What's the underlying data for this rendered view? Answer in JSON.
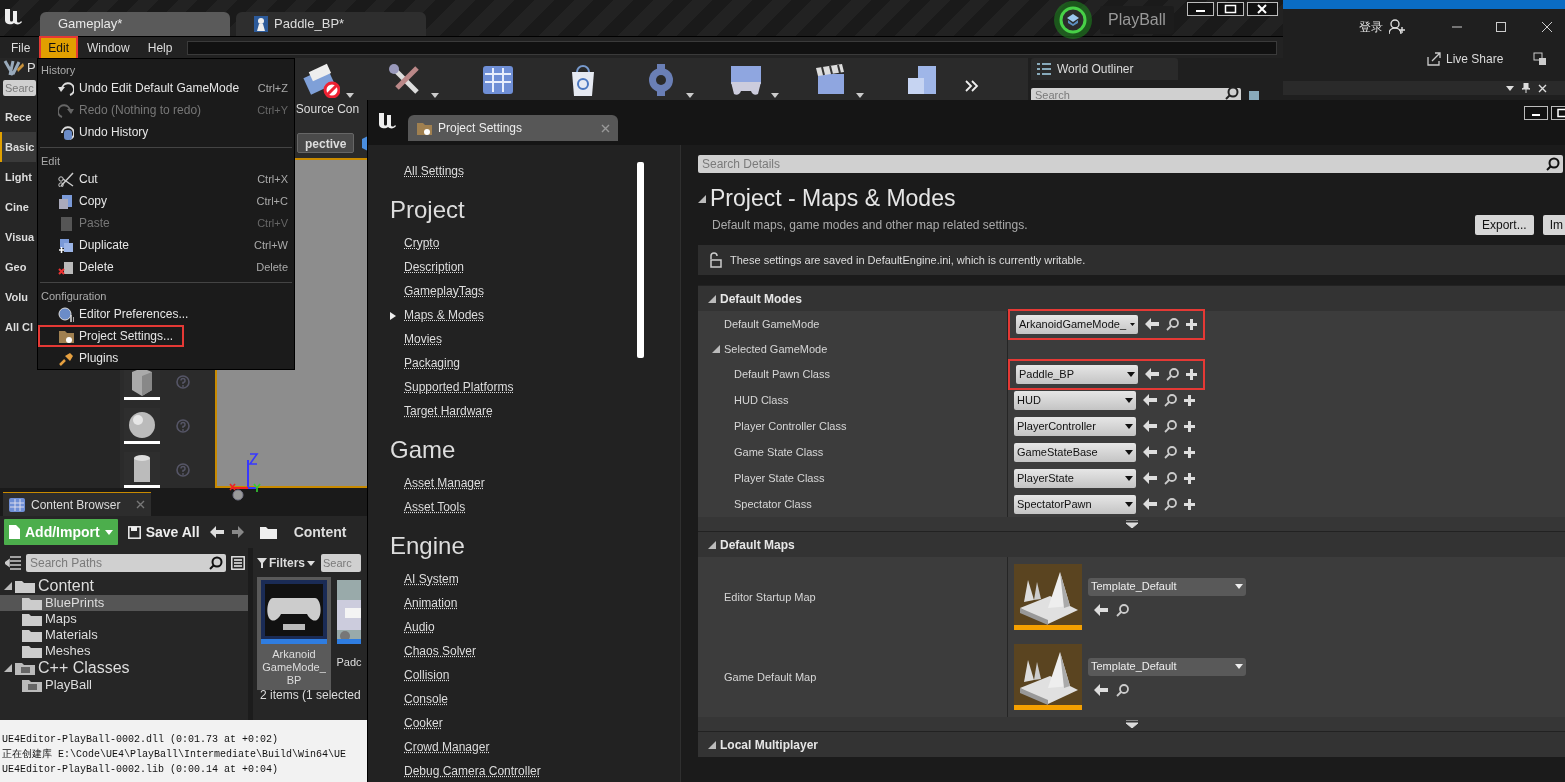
{
  "editor": {
    "tabs": [
      {
        "label": "Gameplay*",
        "selected": true
      },
      {
        "label": "Paddle_BP*",
        "selected": false
      }
    ],
    "play_title": "PlayBall",
    "menu": [
      {
        "label": "File",
        "selected": false,
        "annotated": false
      },
      {
        "label": "Edit",
        "selected": true,
        "annotated": true
      },
      {
        "label": "Window",
        "selected": false,
        "annotated": false
      },
      {
        "label": "Help",
        "selected": false,
        "annotated": false
      }
    ],
    "placement": {
      "title": "P",
      "search_placeholder": "Searc",
      "categories": [
        {
          "label": "Rece",
          "selected": false
        },
        {
          "label": "Basic",
          "selected": true
        },
        {
          "label": "Light",
          "selected": false
        },
        {
          "label": "Cine",
          "selected": false
        },
        {
          "label": "Visua",
          "selected": false
        },
        {
          "label": "Geo",
          "selected": false
        },
        {
          "label": "Volu",
          "selected": false
        },
        {
          "label": "All Cl",
          "selected": false
        }
      ]
    },
    "toolbar_label": "Source Con",
    "viewport_button": "pective",
    "world_outliner": {
      "title": "World Outliner",
      "search_placeholder": "Search"
    },
    "content_browser": {
      "title": "Content Browser",
      "add_button": "Add/Import",
      "save_button": "Save All",
      "breadcrumb": "Content",
      "path_search_placeholder": "Search Paths",
      "filters_label": "Filters",
      "asset_search_placeholder": "Searc",
      "tree": [
        {
          "label": "Content",
          "kind": "folder",
          "expanded": true,
          "selected": false,
          "children": [
            {
              "label": "BluePrints",
              "kind": "folder",
              "selected": true
            },
            {
              "label": "Maps",
              "kind": "folder",
              "selected": false
            },
            {
              "label": "Materials",
              "kind": "folder",
              "selected": false
            },
            {
              "label": "Meshes",
              "kind": "folder",
              "selected": false
            }
          ]
        },
        {
          "label": "C++ Classes",
          "kind": "class_folder",
          "expanded": true,
          "selected": false,
          "children": [
            {
              "label": "PlayBall",
              "kind": "class_folder",
              "selected": false
            }
          ]
        }
      ],
      "assets": [
        {
          "name_lines": [
            "Arkanoid",
            "GameMode_",
            "BP"
          ],
          "kind": "gamemode",
          "selected": true
        },
        {
          "name_lines": [
            "Padc"
          ],
          "kind": "mesh",
          "selected": false
        }
      ],
      "status": "2 items (1 selected"
    },
    "output_log": [
      "UE4Editor-PlayBall-0002.dll (0:01.73 at +0:02)",
      "正在创建库 E:\\Code\\UE4\\PlayBall\\Intermediate\\Build\\Win64\\UE",
      "UE4Editor-PlayBall-0002.lib (0:00.14 at +0:04)"
    ]
  },
  "ide": {
    "login": "登录",
    "live_share": "Live Share"
  },
  "edit_menu": {
    "sections": [
      {
        "heading": "History",
        "items": [
          {
            "label": "Undo Edit Default GameMode",
            "shortcut": "Ctrl+Z",
            "disabled": false,
            "annotated": false
          },
          {
            "label": "Redo (Nothing to redo)",
            "shortcut": "Ctrl+Y",
            "disabled": true,
            "annotated": false
          },
          {
            "label": "Undo History",
            "disabled": false,
            "annotated": false
          }
        ]
      },
      {
        "heading": "Edit",
        "items": [
          {
            "label": "Cut",
            "shortcut": "Ctrl+X",
            "disabled": false,
            "annotated": false
          },
          {
            "label": "Copy",
            "shortcut": "Ctrl+C",
            "disabled": false,
            "annotated": false
          },
          {
            "label": "Paste",
            "shortcut": "Ctrl+V",
            "disabled": true,
            "annotated": false
          },
          {
            "label": "Duplicate",
            "shortcut": "Ctrl+W",
            "disabled": false,
            "annotated": false
          },
          {
            "label": "Delete",
            "shortcut": "Delete",
            "disabled": false,
            "annotated": false
          }
        ]
      },
      {
        "heading": "Configuration",
        "items": [
          {
            "label": "Editor Preferences...",
            "disabled": false,
            "annotated": false
          },
          {
            "label": "Project Settings...",
            "disabled": false,
            "annotated": true
          },
          {
            "label": "Plugins",
            "disabled": false,
            "annotated": false
          }
        ]
      }
    ]
  },
  "project_settings": {
    "tab": "Project Settings",
    "nav": [
      {
        "kind": "link",
        "label": "All Settings",
        "selected": false
      },
      {
        "kind": "heading",
        "label": "Project"
      },
      {
        "kind": "link",
        "label": "Crypto",
        "selected": false
      },
      {
        "kind": "link",
        "label": "Description",
        "selected": false
      },
      {
        "kind": "link",
        "label": "GameplayTags",
        "selected": false
      },
      {
        "kind": "link",
        "label": "Maps & Modes",
        "selected": true
      },
      {
        "kind": "link",
        "label": "Movies",
        "selected": false
      },
      {
        "kind": "link",
        "label": "Packaging",
        "selected": false
      },
      {
        "kind": "link",
        "label": "Supported Platforms",
        "selected": false
      },
      {
        "kind": "link",
        "label": "Target Hardware",
        "selected": false
      },
      {
        "kind": "heading",
        "label": "Game"
      },
      {
        "kind": "link",
        "label": "Asset Manager",
        "selected": false
      },
      {
        "kind": "link",
        "label": "Asset Tools",
        "selected": false
      },
      {
        "kind": "heading",
        "label": "Engine"
      },
      {
        "kind": "link",
        "label": "AI System",
        "selected": false
      },
      {
        "kind": "link",
        "label": "Animation",
        "selected": false
      },
      {
        "kind": "link",
        "label": "Audio",
        "selected": false
      },
      {
        "kind": "link",
        "label": "Chaos Solver",
        "selected": false
      },
      {
        "kind": "link",
        "label": "Collision",
        "selected": false
      },
      {
        "kind": "link",
        "label": "Console",
        "selected": false
      },
      {
        "kind": "link",
        "label": "Cooker",
        "selected": false
      },
      {
        "kind": "link",
        "label": "Crowd Manager",
        "selected": false
      },
      {
        "kind": "link",
        "label": "Debug Camera Controller",
        "selected": false
      }
    ],
    "search_placeholder": "Search Details",
    "title": "Project - Maps & Modes",
    "subtitle": "Default maps, game modes and other map related settings.",
    "export_button": "Export...",
    "import_button": "Im",
    "notice": "These settings are saved in DefaultEngine.ini, which is currently writable.",
    "sections": [
      {
        "title": "Default Modes",
        "expanded": true,
        "rows": [
          {
            "kind": "class",
            "label": "Default GameMode",
            "value": "ArkanoidGameMode_",
            "annotated": true
          },
          {
            "kind": "group",
            "label": "Selected GameMode",
            "expanded": true,
            "children": [
              {
                "kind": "class",
                "label": "Default Pawn Class",
                "value": "Paddle_BP",
                "annotated": true
              },
              {
                "kind": "class",
                "label": "HUD Class",
                "value": "HUD",
                "annotated": false
              },
              {
                "kind": "class",
                "label": "Player Controller Class",
                "value": "PlayerController",
                "annotated": false
              },
              {
                "kind": "class",
                "label": "Game State Class",
                "value": "GameStateBase",
                "annotated": false
              },
              {
                "kind": "class",
                "label": "Player State Class",
                "value": "PlayerState",
                "annotated": false
              },
              {
                "kind": "class",
                "label": "Spectator Class",
                "value": "SpectatorPawn",
                "annotated": false
              }
            ]
          }
        ]
      },
      {
        "title": "Default Maps",
        "expanded": true,
        "rows": [
          {
            "kind": "map",
            "label": "Editor Startup Map",
            "value": "Template_Default",
            "annotated": false
          },
          {
            "kind": "map",
            "label": "Game Default Map",
            "value": "Template_Default",
            "annotated": false
          }
        ]
      },
      {
        "title": "Local Multiplayer",
        "expanded": true
      }
    ]
  }
}
